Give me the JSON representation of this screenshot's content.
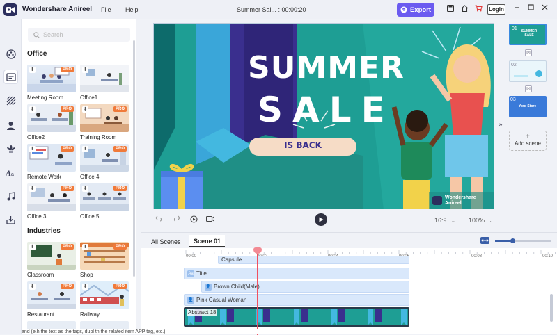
{
  "titlebar": {
    "app_name": "Wondershare Anireel",
    "menu": [
      "File",
      "Help"
    ],
    "doc_title": "Summer Sal... : 00:00:20",
    "export_label": "Export",
    "login_label": "Login"
  },
  "library": {
    "search_placeholder": "Search",
    "sections": [
      {
        "title": "Office",
        "items": [
          {
            "label": "Meeting Room",
            "pro": "PRO"
          },
          {
            "label": "Office1",
            "pro": ""
          },
          {
            "label": "Office2",
            "pro": "PRO"
          },
          {
            "label": "Training Room",
            "pro": "PRO"
          },
          {
            "label": "Remote Work",
            "pro": "PRO"
          },
          {
            "label": "Office 4",
            "pro": "PRO"
          },
          {
            "label": "Office 3",
            "pro": "PRO"
          },
          {
            "label": "Office 5",
            "pro": "PRO"
          }
        ]
      },
      {
        "title": "Industries",
        "items": [
          {
            "label": "Classroom",
            "pro": "PRO"
          },
          {
            "label": "Shop",
            "pro": "PRO"
          },
          {
            "label": "Restaurant",
            "pro": "PRO"
          },
          {
            "label": "Railway",
            "pro": "PRO"
          }
        ]
      }
    ]
  },
  "canvas": {
    "headline_1": "SUMMER",
    "headline_2": "SALE",
    "banner_text": "IS BACK",
    "watermark_line1": "Wondershare",
    "watermark_line2": "Anireel",
    "colors": {
      "teal": "#1e9e94",
      "purple": "#3a2f8e",
      "pill": "#f6dcc6"
    }
  },
  "preview_controls": {
    "aspect": "16:9",
    "zoom": "100%"
  },
  "scenes": {
    "items": [
      {
        "num": "01",
        "text": "SUMMER SALE"
      },
      {
        "num": "02",
        "text": ""
      },
      {
        "num": "03",
        "text": "Your Store"
      }
    ],
    "add_label": "Add scene"
  },
  "timeline": {
    "tabs": [
      "All Scenes",
      "Scene 01"
    ],
    "ticks": [
      "00:00",
      "00:02",
      "00:04",
      "00:06",
      "00:08",
      "00:10"
    ],
    "tracks": [
      {
        "label": "Capsule"
      },
      {
        "label": "Title"
      },
      {
        "label": "Brown Child(Male)"
      },
      {
        "label": "Pink Casual Woman"
      },
      {
        "label": "Abstract 18"
      }
    ]
  },
  "bottom_text": "and (e.h the text as the tags, dupl tn the related item APP tag, etc.)"
}
